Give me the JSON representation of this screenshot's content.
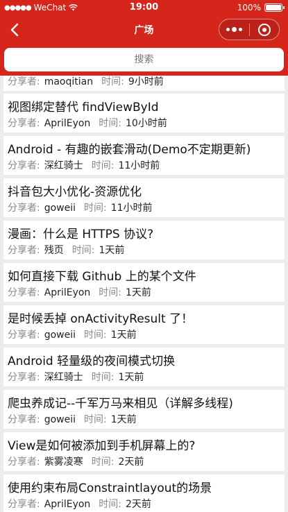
{
  "status_bar": {
    "signal": "●●●●●",
    "carrier": "WeChat",
    "time": "19:00",
    "battery": "100%"
  },
  "nav": {
    "title": "广场"
  },
  "search": {
    "placeholder": "搜索"
  },
  "labels": {
    "sharer": "分享者:",
    "time": "时间:"
  },
  "articles": [
    {
      "title": "",
      "sharer": "maoqitian",
      "time": "9小时前"
    },
    {
      "title": "视图绑定替代 findViewById",
      "sharer": "AprilEyon",
      "time": "10小时前"
    },
    {
      "title": "Android - 有趣的嵌套滑动(Demo不定期更新)",
      "sharer": "深红骑士",
      "time": "11小时前"
    },
    {
      "title": "抖音包大小优化-资源优化",
      "sharer": "goweii",
      "time": "11小时前"
    },
    {
      "title": "漫画：什么是 HTTPS 协议?",
      "sharer": "残页",
      "time": "1天前"
    },
    {
      "title": "如何直接下载 Github 上的某个文件",
      "sharer": "AprilEyon",
      "time": "1天前"
    },
    {
      "title": "是时候丢掉 onActivityResult 了！",
      "sharer": "goweii",
      "time": "1天前"
    },
    {
      "title": "Android 轻量级的夜间模式切换",
      "sharer": "深红骑士",
      "time": "1天前"
    },
    {
      "title": "爬虫养成记--千军万马来相见（详解多线程)",
      "sharer": "goweii",
      "time": "1天前"
    },
    {
      "title": "View是如何被添加到手机屏幕上的?",
      "sharer": "紫雾凌寒",
      "time": "2天前"
    },
    {
      "title": "使用约束布局Constraintlayout的场景",
      "sharer": "AprilEyon",
      "time": "2天前"
    }
  ]
}
